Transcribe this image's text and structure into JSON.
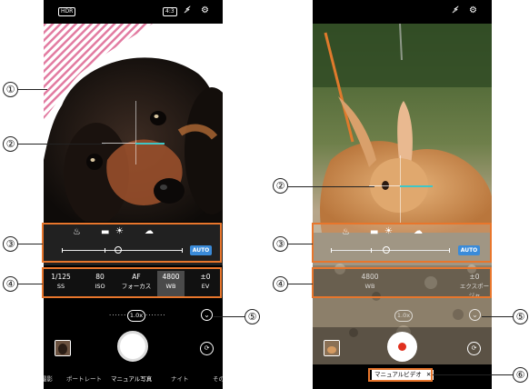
{
  "left_phone": {
    "status": {
      "hdr_badge": "HDR",
      "ratio_badge": "4:3"
    },
    "light_icons": [
      "light-bulb-icon",
      "fluorescent-icon",
      "sun-icon",
      "cloud-icon"
    ],
    "auto_label": "AUTO",
    "params": [
      {
        "value": "1/125",
        "label": "SS",
        "selected": false
      },
      {
        "value": "80",
        "label": "ISO",
        "selected": false
      },
      {
        "value": "AF",
        "label": "フォーカス",
        "selected": false
      },
      {
        "value": "4800",
        "label": "WB",
        "selected": true
      },
      {
        "value": "±0",
        "label": "EV",
        "selected": false
      }
    ],
    "zoom_label": "1.0x",
    "modes": [
      "撮影",
      "ポートレート",
      "マニュアル写真",
      "ナイト",
      "その"
    ],
    "active_mode": "マニュアル写真"
  },
  "right_phone": {
    "auto_label": "AUTO",
    "params": [
      {
        "value": "4800",
        "label": "WB"
      },
      {
        "value": "±0",
        "label": "エクスポージャ"
      }
    ],
    "zoom_label": "1.0x",
    "mode_chip": "マニュアルビデオ"
  },
  "callouts": {
    "c1": "①",
    "c2": "②",
    "c3": "③",
    "c4": "④",
    "c5": "⑤",
    "c6": "⑥"
  },
  "colors": {
    "highlight": "#e8762c",
    "auto_button": "#3a8bd9",
    "focus_line": "#3ec7c7",
    "record": "#e0301e"
  }
}
